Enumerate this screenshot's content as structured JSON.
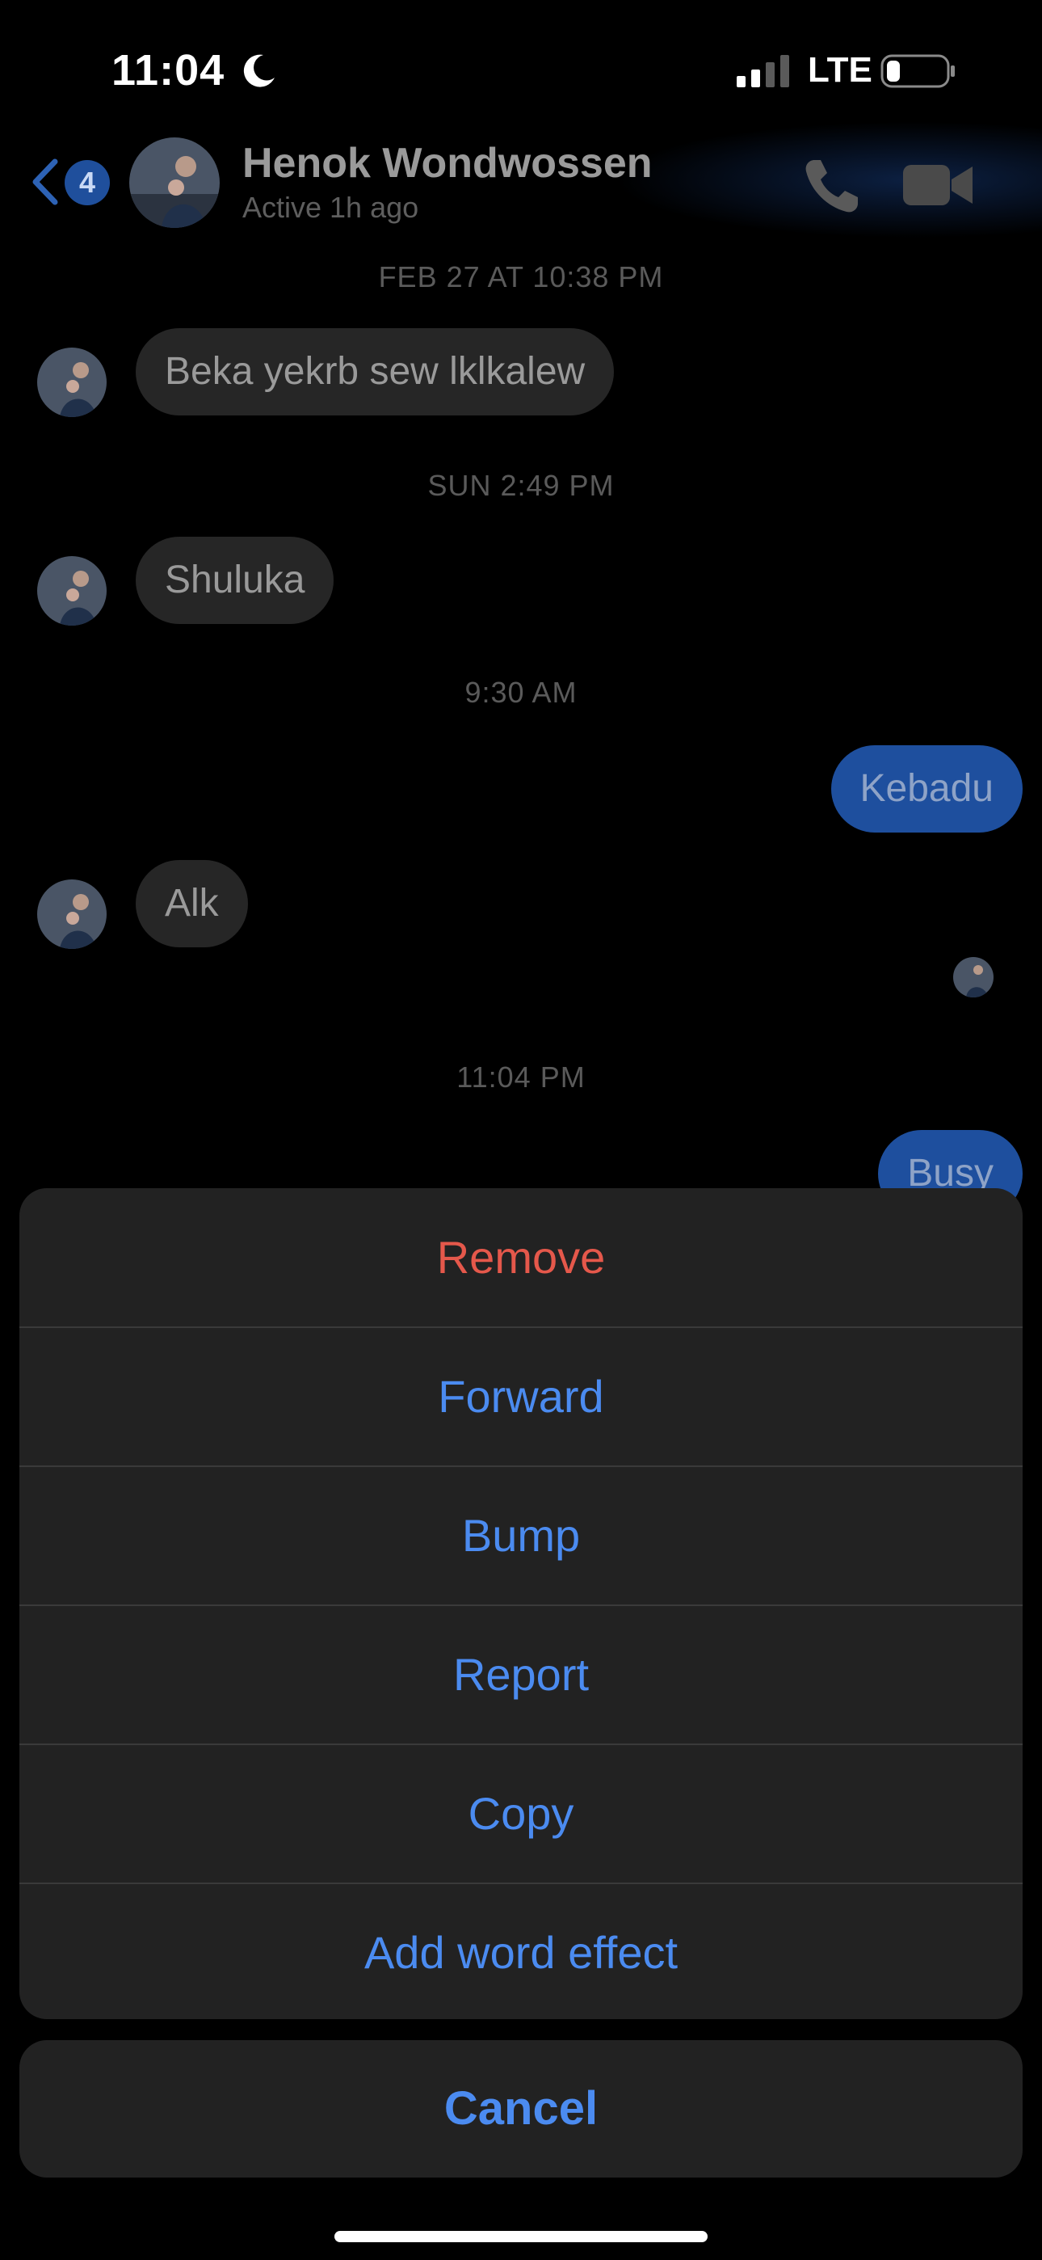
{
  "status_bar": {
    "time": "11:04",
    "network": "LTE",
    "icons": [
      "moon-icon",
      "signal-icon",
      "battery-icon"
    ]
  },
  "header": {
    "back_badge": "4",
    "contact_name": "Henok Wondwossen",
    "contact_status": "Active 1h ago",
    "icons": [
      "back-chevron-icon",
      "phone-icon",
      "video-camera-icon"
    ],
    "accent_color": "#1e4f9e"
  },
  "chat": {
    "timestamps": [
      "FEB 27 AT 10:38 PM",
      "SUN 2:49 PM",
      "9:30 AM",
      "11:04 PM"
    ],
    "messages": [
      {
        "direction": "incoming",
        "text": "Beka yekrb sew lklkalew"
      },
      {
        "direction": "incoming",
        "text": "Shuluka"
      },
      {
        "direction": "outgoing",
        "text": "Kebadu"
      },
      {
        "direction": "incoming",
        "text": "Alk"
      },
      {
        "direction": "outgoing",
        "text": "Busy"
      }
    ]
  },
  "action_sheet": {
    "items": [
      {
        "label": "Remove",
        "color": "#e5584b"
      },
      {
        "label": "Forward",
        "color": "#4b8bf0"
      },
      {
        "label": "Bump",
        "color": "#4b8bf0"
      },
      {
        "label": "Report",
        "color": "#4b8bf0"
      },
      {
        "label": "Copy",
        "color": "#4b8bf0"
      },
      {
        "label": "Add word effect",
        "color": "#4b8bf0"
      }
    ],
    "cancel_label": "Cancel"
  }
}
